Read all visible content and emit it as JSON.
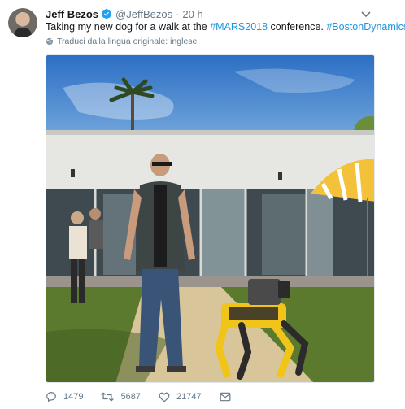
{
  "tweet": {
    "author_name": "Jeff Bezos",
    "handle": "@JeffBezos",
    "separator": "·",
    "time": "20 h",
    "text_before": "Taking my new dog for a walk at the ",
    "hashtag1": "#MARS2018",
    "text_middle": " conference. ",
    "hashtag2": "#BostonDynamics",
    "translate_label": "Traduci dalla lingua originale: inglese"
  },
  "actions": {
    "replies": "1479",
    "retweets": "5687",
    "likes": "21747"
  },
  "icons": {
    "verified": "verified-badge-icon",
    "caret": "chevron-down-icon",
    "globe": "globe-icon",
    "reply": "reply-icon",
    "retweet": "retweet-icon",
    "like": "heart-icon",
    "dm": "envelope-icon"
  },
  "colors": {
    "accent": "#1b95e0",
    "muted": "#657786",
    "text": "#14171a"
  }
}
